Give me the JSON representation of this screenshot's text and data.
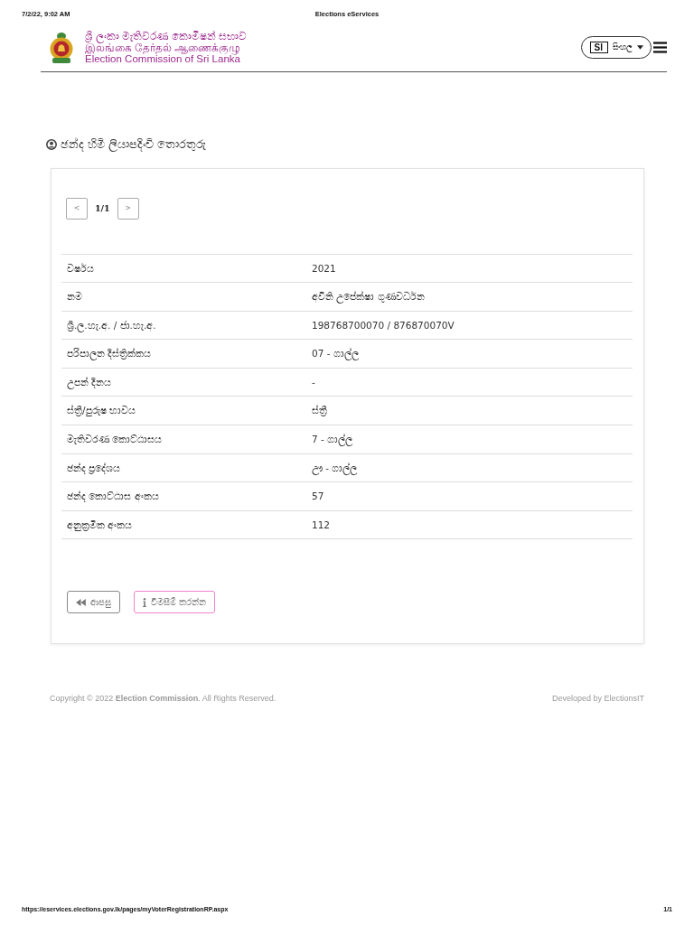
{
  "print_header": {
    "datetime": "7/2/22, 9:02 AM",
    "title": "Elections eServices"
  },
  "site_header": {
    "brand_lines": [
      "ශ්‍රී ලංකා මැතිවරණ කොමිෂන් සභාව",
      "இலங்கை தேர்தல் ஆணைக்குழு",
      "Election Commission of Sri Lanka"
    ],
    "language": {
      "code": "SI",
      "label": "සිංහල"
    }
  },
  "page_heading": "ඡන්ද හිමි ලියාපදිංචි තොරතුරු",
  "pager": {
    "previous": "<",
    "position": "1/1",
    "next": ">"
  },
  "details": [
    {
      "label": "වර්ෂය",
      "value": "2021"
    },
    {
      "label": "නම",
      "value": "අවිනි උපේක්ෂා ගුණවර්ධන"
    },
    {
      "label": "ශ්‍රී.ල.හැ.අ. / ජා.හැ.අ.",
      "value": "198768700070 / 876870070V"
    },
    {
      "label": "පරිපාලන දිස්ත්‍රික්කය",
      "value": "07 - ගාල්ල"
    },
    {
      "label": "උපන් දිනය",
      "value": "-"
    },
    {
      "label": "ස්ත්‍රී/පුරුෂ භාවය",
      "value": "ස්ත්‍රී"
    },
    {
      "label": "මැතිවරණ කොට්ඨාසය",
      "value": "7 - ගාල්ල"
    },
    {
      "label": "ඡන්ද ප්‍රදේශය",
      "value": "ඌ - ගාල්ල"
    },
    {
      "label": "ඡන්ද කොට්ඨාස අංකය",
      "value": "57"
    },
    {
      "label": "අනුක්‍රමික අංකය",
      "value": "112"
    }
  ],
  "actions": [
    {
      "kind": "back",
      "label": "ආපසු"
    },
    {
      "kind": "enquiry",
      "label": "විමසීම් කරන්න"
    }
  ],
  "footer": {
    "copyright": "Copyright © 2022 **Election Commission**. All Rights Reserved.",
    "credit": "Developed by ElectionsIT"
  },
  "print_footer": {
    "url": "https://eservices.elections.gov.lk/pages/myVoterRegistrationRP.aspx",
    "page": "1/1"
  }
}
